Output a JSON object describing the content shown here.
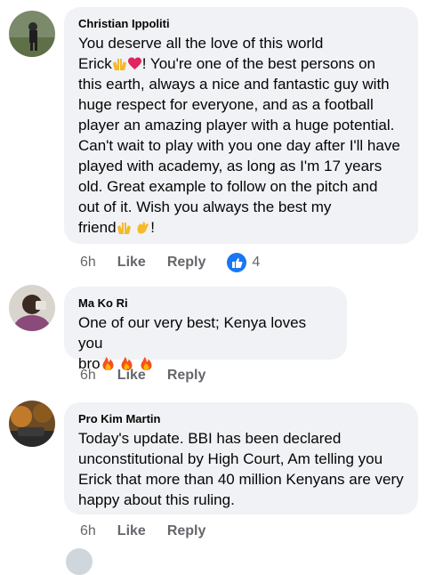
{
  "comments": [
    {
      "author": "Christian Ippoliti",
      "text_parts": [
        "You deserve all the love of this world\nErick",
        "! You're one of the best persons on\nthis earth, always a nice and fantastic guy with\nhuge respect for everyone, and as a football\nplayer an amazing player with a huge potential.\nCan't wait to play with you one day after I'll have\nplayed with academy, as long as I'm 17 years\nold. Great example to follow on the pitch and\nout of it. Wish you always the best my\nfriend",
        "!"
      ],
      "time": "6h",
      "like_label": "Like",
      "reply_label": "Reply",
      "reaction_count": "4"
    },
    {
      "author": "Ma Ko Ri",
      "text_parts": [
        "One of our very best; Kenya loves you\nbro"
      ],
      "time": "6h",
      "like_label": "Like",
      "reply_label": "Reply"
    },
    {
      "author": "Pro Kim Martin",
      "text_parts": [
        "Today's update. BBI has been declared\nunconstitutional by High Court, Am telling you\nErick that more than 40 million Kenyans are very\nhappy about this ruling."
      ],
      "time": "6h",
      "like_label": "Like",
      "reply_label": "Reply"
    }
  ],
  "colors": {
    "bubble": "#f0f2f5",
    "meta": "#65676b",
    "like_blue": "#1877f2"
  },
  "icons": [
    "raising-hands-emoji",
    "red-heart-emoji",
    "waving-hand-emoji",
    "fire-emoji",
    "thumbs-up-icon"
  ]
}
